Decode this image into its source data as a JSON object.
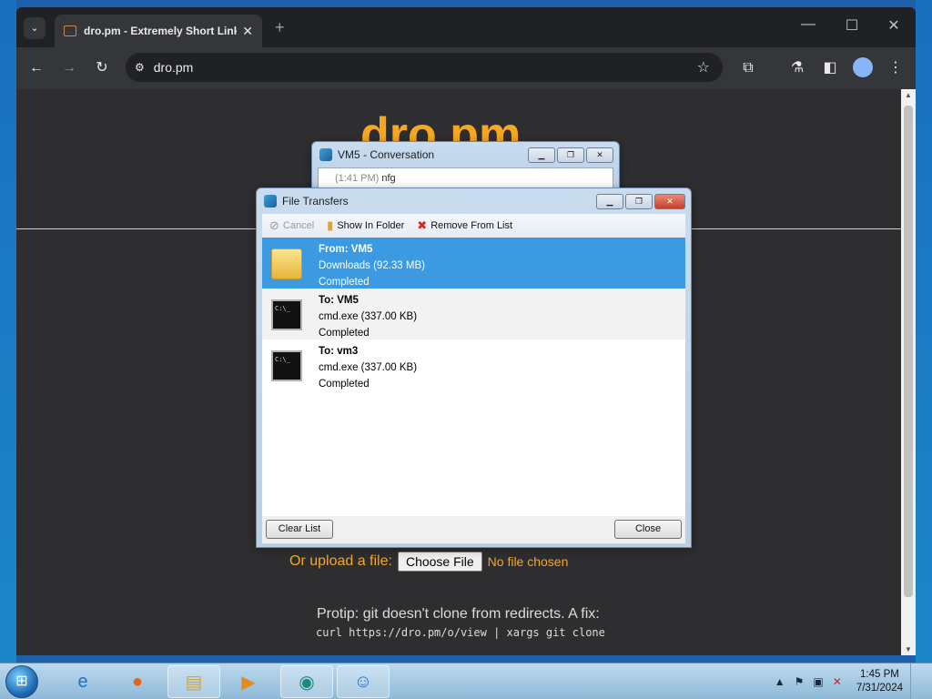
{
  "browser": {
    "tab_title": "dro.pm - Extremely Short Links",
    "tab_close": "✕",
    "new_tab": "+",
    "url": "dro.pm",
    "win_minimize": "—",
    "win_maximize": "☐",
    "win_close": "✕"
  },
  "page": {
    "logo": "dro.pm",
    "upload_label": "Or upload a file:",
    "choose_file": "Choose File",
    "no_file": "No file chosen",
    "protip": "Protip: git doesn't clone from redirects. A fix:",
    "command": "curl https://dro.pm/o/view | xargs git clone"
  },
  "conversation": {
    "title": "VM5 - Conversation",
    "time": "(1:41 PM)",
    "message": "nfg"
  },
  "file_transfers": {
    "title": "File Transfers",
    "cancel": "Cancel",
    "show_in_folder": "Show In Folder",
    "remove_from_list": "Remove From List",
    "items": [
      {
        "head": "From: VM5",
        "file": "Downloads (92.33 MB)",
        "status": "Completed"
      },
      {
        "head": "To: VM5",
        "file": "cmd.exe (337.00 KB)",
        "status": "Completed"
      },
      {
        "head": "To: vm3",
        "file": "cmd.exe (337.00 KB)",
        "status": "Completed"
      }
    ],
    "cmd_icon_text": "C:\\_",
    "clear_list": "Clear List",
    "close": "Close"
  },
  "taskbar": {
    "clock_time": "1:45 PM",
    "clock_date": "7/31/2024"
  }
}
